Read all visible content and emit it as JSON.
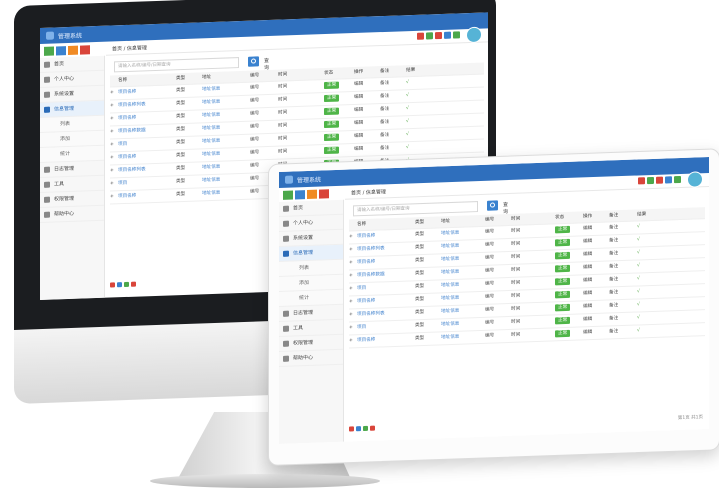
{
  "app": {
    "title": "管理系统",
    "crumb": "首页 / 信息管理"
  },
  "search": {
    "placeholder": "请输入名称/编号/日期查询",
    "label": "查询"
  },
  "sidebar": {
    "items": [
      {
        "label": "首页",
        "active": false,
        "sub": false
      },
      {
        "label": "个人中心",
        "active": false,
        "sub": false
      },
      {
        "label": "系统设置",
        "active": false,
        "sub": false
      },
      {
        "label": "信息管理",
        "active": true,
        "sub": false
      },
      {
        "label": "列表",
        "active": false,
        "sub": true
      },
      {
        "label": "添加",
        "active": false,
        "sub": true
      },
      {
        "label": "统计",
        "active": false,
        "sub": true
      },
      {
        "label": "日志管理",
        "active": false,
        "sub": false
      },
      {
        "label": "工具",
        "active": false,
        "sub": false
      },
      {
        "label": "权限管理",
        "active": false,
        "sub": false
      },
      {
        "label": "帮助中心",
        "active": false,
        "sub": false
      }
    ]
  },
  "table": {
    "columns": [
      "",
      "名称",
      "类型",
      "地址",
      "编号",
      "时间",
      "状态",
      "操作",
      "备注",
      "结果"
    ],
    "rows": [
      [
        "+",
        "项目名称",
        "类型",
        "地址信息",
        "编号",
        "时间",
        "正常",
        "编辑",
        "备注",
        "√"
      ],
      [
        "+",
        "项目名称列表",
        "类型",
        "地址信息",
        "编号",
        "时间",
        "正常",
        "编辑",
        "备注",
        "√"
      ],
      [
        "+",
        "项目名称",
        "类型",
        "地址信息",
        "编号",
        "时间",
        "正常",
        "编辑",
        "备注",
        "√"
      ],
      [
        "+",
        "项目名称数据",
        "类型",
        "地址信息",
        "编号",
        "时间",
        "正常",
        "编辑",
        "备注",
        "√"
      ],
      [
        "+",
        "项目",
        "类型",
        "地址信息",
        "编号",
        "时间",
        "正常",
        "编辑",
        "备注",
        "√"
      ],
      [
        "+",
        "项目名称",
        "类型",
        "地址信息",
        "编号",
        "时间",
        "正常",
        "编辑",
        "备注",
        "√"
      ],
      [
        "+",
        "项目名称列表",
        "类型",
        "地址信息",
        "编号",
        "时间",
        "正常",
        "编辑",
        "备注",
        "√"
      ],
      [
        "+",
        "项目",
        "类型",
        "地址信息",
        "编号",
        "时间",
        "正常",
        "编辑",
        "备注",
        "√"
      ],
      [
        "+",
        "项目名称",
        "类型",
        "地址信息",
        "编号",
        "时间",
        "正常",
        "编辑",
        "备注",
        "√"
      ]
    ]
  },
  "pager": {
    "text": "第1页 共1页"
  },
  "colors": {
    "topbar": "#2f6fbd",
    "quick": [
      "#4ca84b",
      "#3a82cf",
      "#f08a24",
      "#d9453a"
    ],
    "toolbar": [
      "#d9453a",
      "#4ca84b",
      "#d9453a",
      "#3a82cf",
      "#4ca84b"
    ],
    "footer": [
      "#d9453a",
      "#3a82cf",
      "#4ca84b",
      "#d9453a"
    ]
  }
}
